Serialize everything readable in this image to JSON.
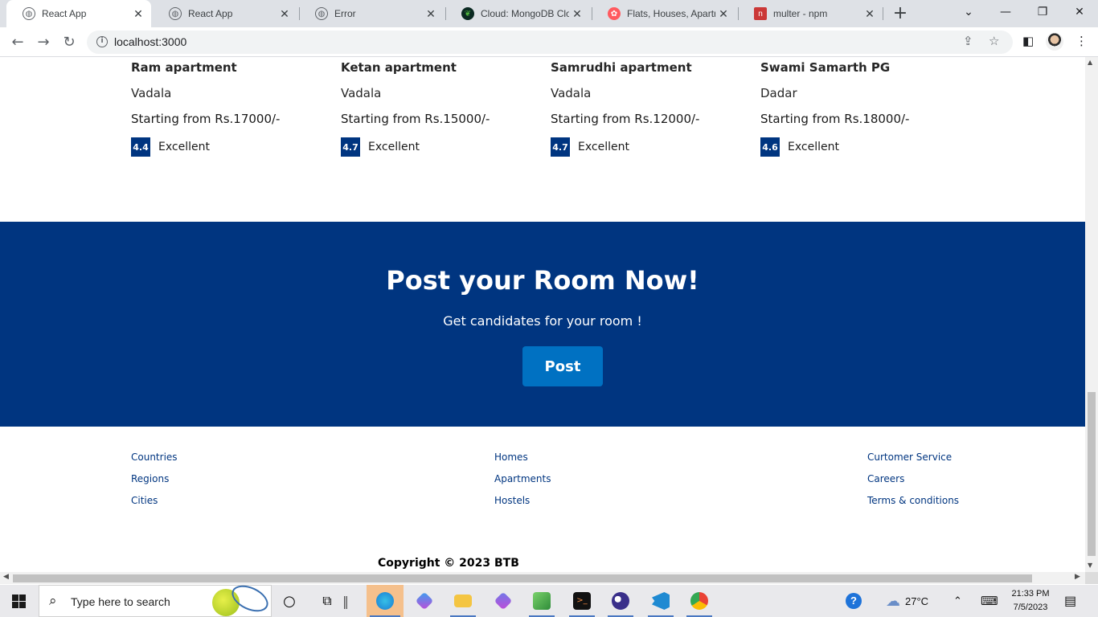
{
  "browser": {
    "tabs": [
      {
        "title": "React App",
        "icon": "globe-icon"
      },
      {
        "title": "React App",
        "icon": "globe-icon"
      },
      {
        "title": "Error",
        "icon": "globe-icon"
      },
      {
        "title": "Cloud: MongoDB Cloud",
        "icon": "mongodb-leaf-icon"
      },
      {
        "title": "Flats, Houses, Apartments",
        "icon": "airbnb-icon"
      },
      {
        "title": "multer - npm",
        "icon": "npm-icon"
      }
    ],
    "url": "localhost:3000",
    "close_glyph": "✕",
    "new_tab_glyph": "+"
  },
  "listings": [
    {
      "name": "Ram apartment",
      "location": "Vadala",
      "price": "Starting from Rs.17000/-",
      "score": "4.4",
      "rating_word": "Excellent"
    },
    {
      "name": "Ketan apartment",
      "location": "Vadala",
      "price": "Starting from Rs.15000/-",
      "score": "4.7",
      "rating_word": "Excellent"
    },
    {
      "name": "Samrudhi apartment",
      "location": "Vadala",
      "price": "Starting from Rs.12000/-",
      "score": "4.7",
      "rating_word": "Excellent"
    },
    {
      "name": "Swami Samarth PG",
      "location": "Dadar",
      "price": "Starting from Rs.18000/-",
      "score": "4.6",
      "rating_word": "Excellent"
    }
  ],
  "promo": {
    "title": "Post your Room Now!",
    "subtitle": "Get candidates for your room !",
    "button": "Post"
  },
  "footer": {
    "col1": [
      "Countries",
      "Regions",
      "Cities"
    ],
    "col2": [
      "Homes",
      "Apartments",
      "Hostels"
    ],
    "col3": [
      "Curtomer Service",
      "Careers",
      "Terms & conditions"
    ],
    "copyright": "Copyright © 2023 BTB"
  },
  "taskbar": {
    "search_placeholder": "Type here to search",
    "weather": "27°C",
    "time": "21:33 PM",
    "date": "7/5/2023"
  },
  "colors": {
    "brand_dark": "#003580",
    "button": "#0071c2"
  }
}
